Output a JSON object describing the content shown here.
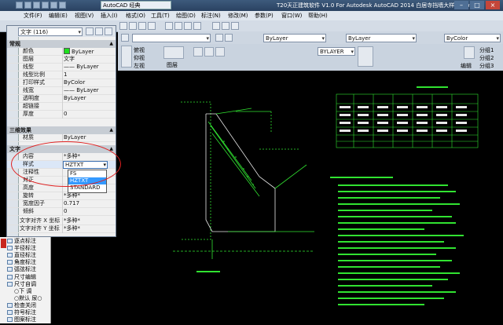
{
  "titlebar": {
    "workspace": "AutoCAD 经典",
    "title": "T20天正建筑软件 V1.0 For Autodesk AutoCAD 2014    白居寺挡墙大样图.dwg"
  },
  "menubar": {
    "items": [
      "文件(F)",
      "编辑(E)",
      "视图(V)",
      "插入(I)",
      "格式(O)",
      "工具(T)",
      "绘图(D)",
      "标注(N)",
      "修改(M)",
      "参数(P)",
      "窗口(W)",
      "帮助(H)"
    ]
  },
  "toolbar": {
    "layer_combo": "ByLayer",
    "layer_combo2": "ByLayer",
    "color_combo": "ByColor"
  },
  "ribbon": {
    "views": [
      "俯视",
      "仰视",
      "左视"
    ],
    "layer_btn": "图层",
    "layer_name": "BYLAYER",
    "edit_btn": "编辑",
    "groups": [
      "分组1",
      "分组2",
      "分组3"
    ]
  },
  "properties": {
    "selector": "文字 (116)",
    "sections": {
      "general": "常规",
      "three_d": "三维效果",
      "text": "文字"
    },
    "general_rows": [
      {
        "k": "颜色",
        "v": "ByLayer",
        "swatch": true
      },
      {
        "k": "图层",
        "v": "文字"
      },
      {
        "k": "线型",
        "v": "—— ByLayer"
      },
      {
        "k": "线型比例",
        "v": "1"
      },
      {
        "k": "打印样式",
        "v": "ByColor"
      },
      {
        "k": "线宽",
        "v": "—— ByLayer"
      },
      {
        "k": "透明度",
        "v": "ByLayer"
      },
      {
        "k": "超链接",
        "v": ""
      },
      {
        "k": "厚度",
        "v": "0"
      }
    ],
    "three_d_rows": [
      {
        "k": "材质",
        "v": "ByLayer"
      }
    ],
    "text_rows": [
      {
        "k": "内容",
        "v": "*多种*"
      },
      {
        "k": "样式",
        "v": "HZTXT"
      },
      {
        "k": "注释性",
        "v": ""
      },
      {
        "k": "对正",
        "v": ""
      },
      {
        "k": "高度",
        "v": ""
      },
      {
        "k": "旋转",
        "v": "*多种*"
      },
      {
        "k": "宽度因子",
        "v": "0.717"
      },
      {
        "k": "倾斜",
        "v": "0"
      },
      {
        "k": "文字对齐 X 坐标",
        "v": "*多种*"
      },
      {
        "k": "文字对齐 Y 坐标",
        "v": "*多种*"
      }
    ],
    "style_dropdown": {
      "selected": "HZTXT",
      "options": [
        "FS",
        "HZTXT",
        "STANDARD"
      ]
    }
  },
  "tools": {
    "items": [
      "逐点标注",
      "半径标注",
      "直径标注",
      "角度标注",
      "弧弦标注",
      "尺寸编辑",
      "尺寸自调",
      "○下 调",
      "○默认 尿○",
      "检查关闭",
      "符号标注",
      "图案标注"
    ]
  },
  "colors": {
    "drawing_text": "#31e331",
    "selection_oval": "#e02020",
    "highlight": "#3399ff"
  }
}
